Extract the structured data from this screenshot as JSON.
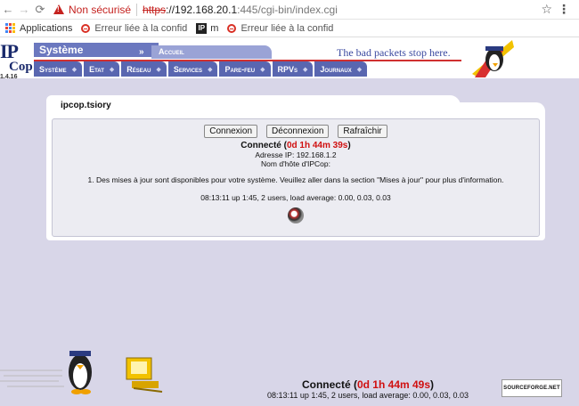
{
  "browser": {
    "security_label": "Non sécurisé",
    "url_scheme": "https",
    "url_host": "://192.168.20.1",
    "url_rest": ":445/cgi-bin/index.cgi",
    "bookmarks": [
      {
        "label": "Applications",
        "icon": "apps-grid-icon"
      },
      {
        "label": "Erreur liée à la confid",
        "icon": "error-circle-icon"
      },
      {
        "label": "m",
        "icon": "ip-favicon"
      },
      {
        "label": "Erreur liée à la confid",
        "icon": "error-circle-icon"
      }
    ]
  },
  "header": {
    "logo_top": "IP",
    "logo_bottom": "Cop",
    "version": "1.4.16",
    "section_title": "Système",
    "crumb": "Accueil",
    "slogan": "The bad packets stop here.",
    "menu": [
      "Système",
      "Etat",
      "Réseau",
      "Services",
      "Pare-feu",
      "RPVs",
      "Journaux"
    ]
  },
  "panel": {
    "title": "ipcop.tsiory",
    "buttons": {
      "connect": "Connexion",
      "disconnect": "Déconnexion",
      "refresh": "Rafraîchir"
    },
    "status_prefix": "Connecté (",
    "status_uptime": "0d 1h 44m 39s",
    "status_suffix": ")",
    "ip_line": "Adresse IP: 192.168.1.2",
    "host_line": "Nom d'hôte d'IPCop:",
    "updates_line": "1. Des mises à jour sont disponibles pour votre système. Veuillez aller dans la section \"Mises à jour\" pour plus d'information.",
    "uptime_line": "08:13:11 up 1:45, 2 users, load average: 0.00, 0.03, 0.03"
  },
  "footer": {
    "status_prefix": "Connecté (",
    "status_uptime": "0d 1h 44m 49s",
    "status_suffix": ")",
    "uptime_line": "08:13:11 up 1:45, 2 users, load average: 0.00, 0.03, 0.03",
    "sourceforge": "SOURCEFORGE.NET"
  }
}
